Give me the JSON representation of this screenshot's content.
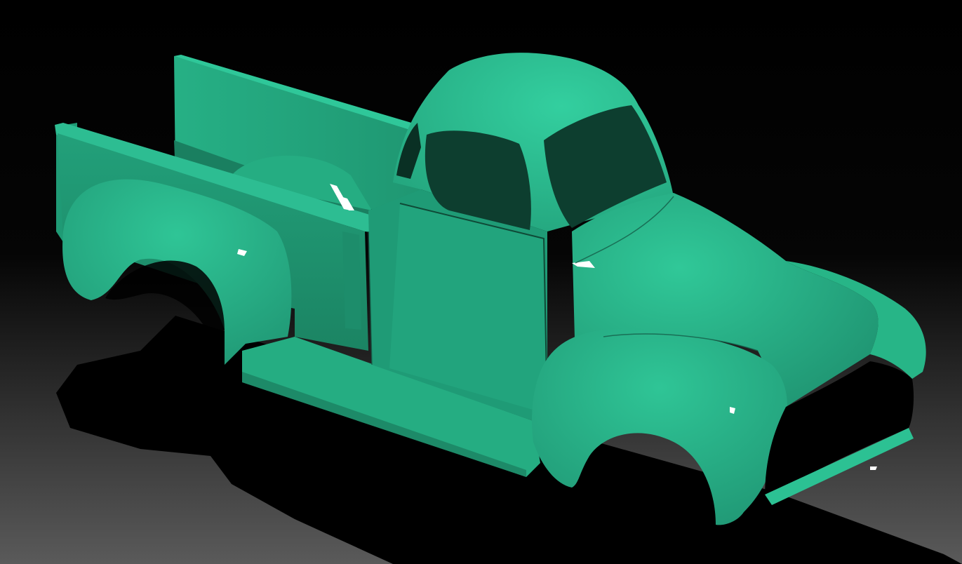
{
  "viewport": {
    "background_top": "#000000",
    "background_bottom": "#5a5a5a",
    "shadow_color": "#000000"
  },
  "model": {
    "subject": "pickup-truck-body",
    "body_color": "#2cc193",
    "body_shade": "#1d8a68",
    "body_dark": "#0d3e2f",
    "highlight_color": "#ffffff"
  }
}
